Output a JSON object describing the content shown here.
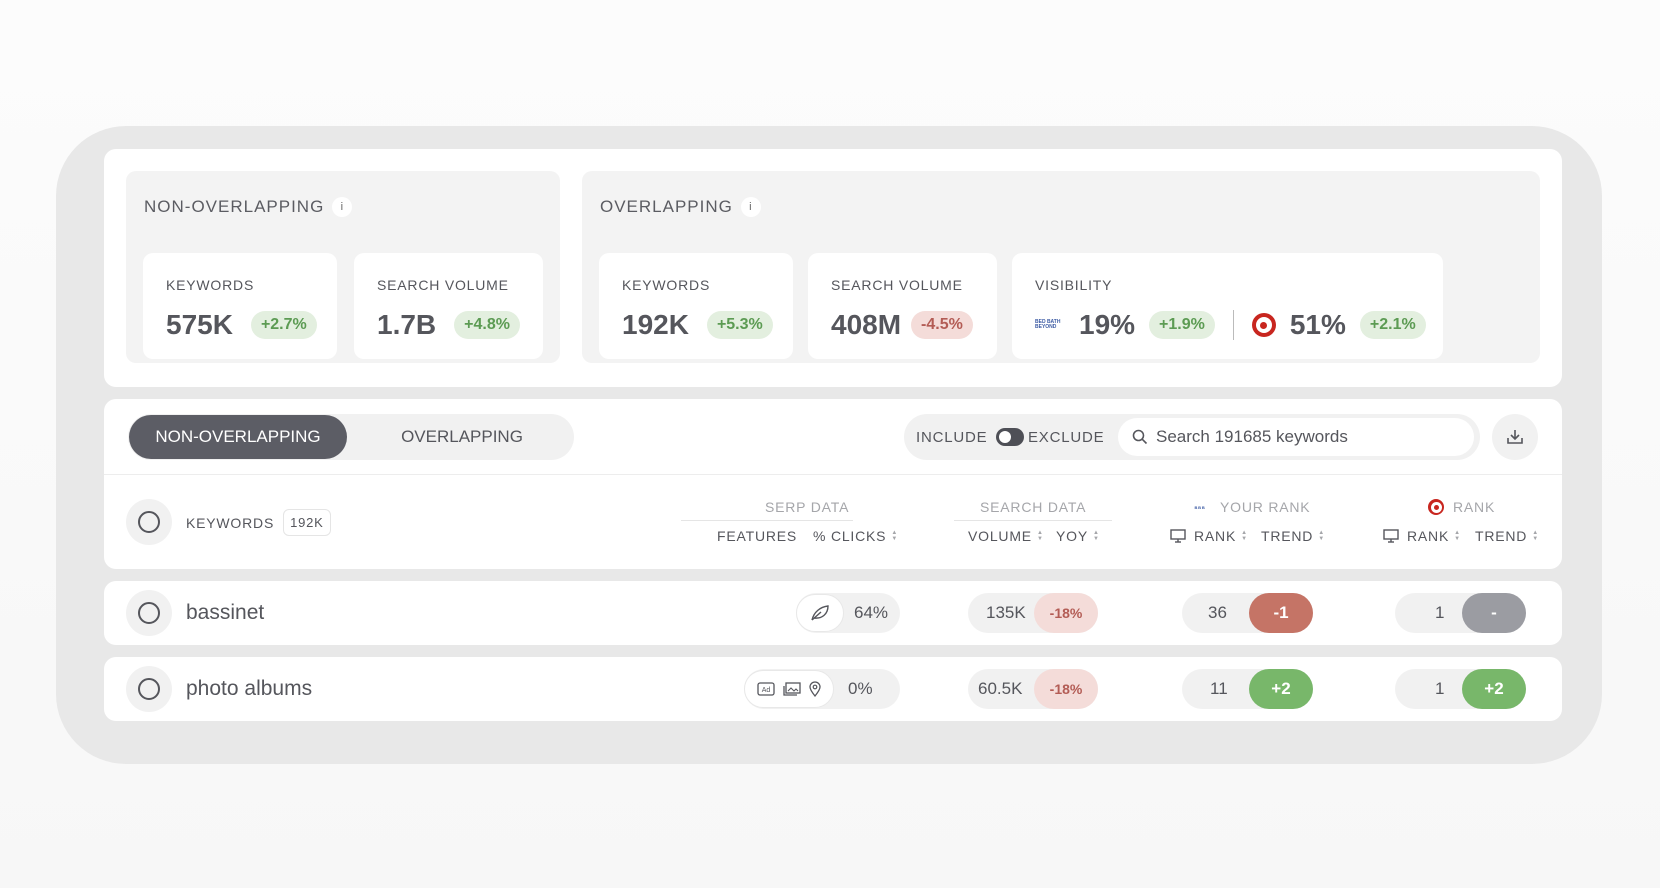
{
  "summary": {
    "non_overlapping": {
      "title": "NON-OVERLAPPING",
      "info": "i",
      "keywords": {
        "label": "KEYWORDS",
        "value": "575K",
        "change": "+2.7%"
      },
      "search_volume": {
        "label": "SEARCH VOLUME",
        "value": "1.7B",
        "change": "+4.8%"
      }
    },
    "overlapping": {
      "title": "OVERLAPPING",
      "info": "i",
      "keywords": {
        "label": "KEYWORDS",
        "value": "192K",
        "change": "+5.3%"
      },
      "search_volume": {
        "label": "SEARCH VOLUME",
        "value": "408M",
        "change": "-4.5%"
      },
      "visibility": {
        "label": "VISIBILITY",
        "brand_a": {
          "logo_text": "BED BATH BEYOND",
          "value": "19%",
          "change": "+1.9%"
        },
        "brand_b": {
          "logo_icon": "target-logo-icon",
          "value": "51%",
          "change": "+2.1%"
        }
      }
    }
  },
  "tabs": {
    "active": "NON-OVERLAPPING",
    "inactive": "OVERLAPPING"
  },
  "filter": {
    "include_label": "INCLUDE",
    "exclude_label": "EXCLUDE",
    "search_placeholder": "Search 191685 keywords"
  },
  "table": {
    "headers": {
      "keywords": "KEYWORDS",
      "keywords_count": "192K",
      "serp_group": "SERP DATA",
      "features": "FEATURES",
      "clicks": "% CLICKS",
      "search_group": "SEARCH DATA",
      "volume": "VOLUME",
      "yoy": "YOY",
      "your_rank_group": "YOUR RANK",
      "rank_group": "RANK",
      "rank": "RANK",
      "trend": "TREND"
    },
    "rows": [
      {
        "keyword": "bassinet",
        "features": [
          "leaf-icon"
        ],
        "clicks": "64%",
        "volume": "135K",
        "yoy": "-18%",
        "your_rank": "36",
        "your_trend": "-1",
        "competitor_rank": "1",
        "competitor_trend": "-"
      },
      {
        "keyword": "photo albums",
        "features": [
          "ad-icon",
          "images-icon",
          "location-pin-icon"
        ],
        "clicks": "0%",
        "volume": "60.5K",
        "yoy": "-18%",
        "your_rank": "11",
        "your_trend": "+2",
        "competitor_rank": "1",
        "competitor_trend": "+2"
      }
    ]
  },
  "colors": {
    "accent_dark": "#5c5d65",
    "positive": "#5c9b53",
    "negative": "#b35c55",
    "trend_up": "#78b76a",
    "trend_down": "#c57466",
    "trend_flat": "#9b9ca2"
  }
}
